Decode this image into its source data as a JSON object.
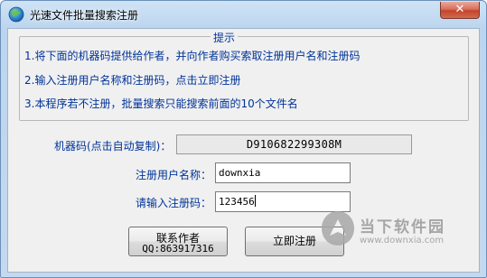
{
  "window": {
    "title": "光速文件批量搜索注册",
    "close_glyph": "✕"
  },
  "tips": {
    "legend": "提示",
    "lines": [
      "1.将下面的机器码提供给作者，并向作者购买索取注册用户名和注册码",
      "2.输入注册用户名称和注册码，点击立即注册",
      "3.本程序若不注册，批量搜索只能搜索前面的10个文件名"
    ]
  },
  "machine_code": {
    "label": "机器码(点击自动复制)：",
    "value": "D910682299308M"
  },
  "username": {
    "label": "注册用户名称：",
    "value": "downxia"
  },
  "regcode": {
    "label": "请输入注册码：",
    "value": "123456"
  },
  "buttons": {
    "contact_line1": "联系作者",
    "contact_line2": "QQ:863917316",
    "register": "立即注册"
  },
  "watermark": {
    "name": "当下软件园",
    "url": "www.downxia.com"
  }
}
